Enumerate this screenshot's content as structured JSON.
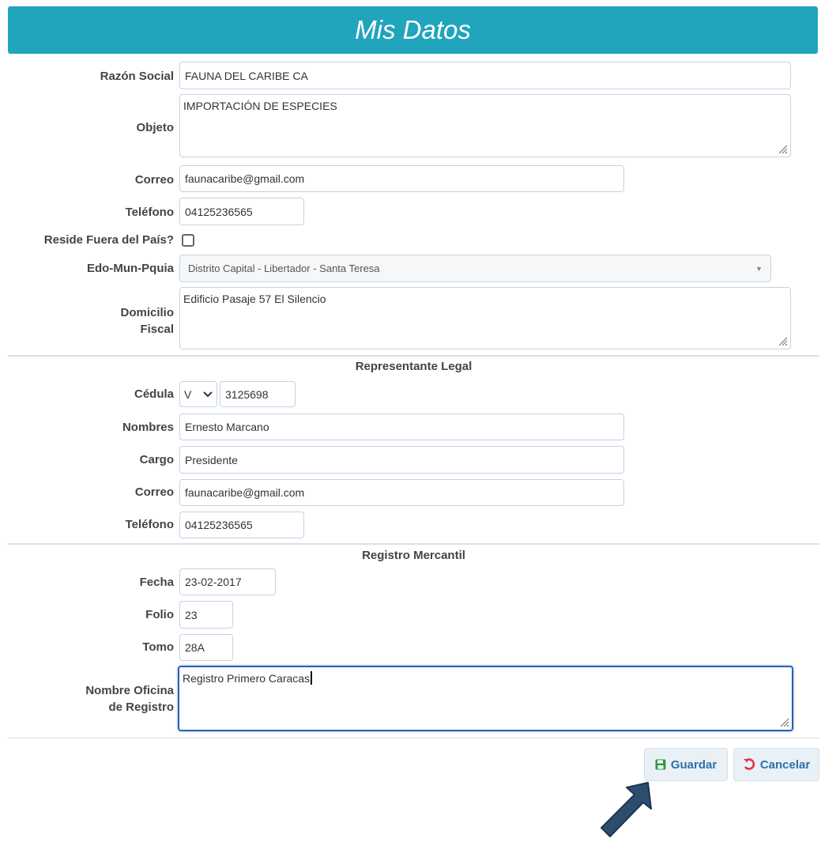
{
  "page_title": "Mis Datos",
  "company": {
    "razon_social_label": "Razón Social",
    "razon_social": "FAUNA DEL CARIBE CA",
    "objeto_label": "Objeto",
    "objeto": "IMPORTACIÓN DE ESPECIES",
    "correo_label": "Correo",
    "correo": "faunacaribe@gmail.com",
    "telefono_label": "Teléfono",
    "telefono": "04125236565",
    "reside_label": "Reside Fuera del País?",
    "reside_checked": false,
    "edo_label": "Edo-Mun-Pquia",
    "edo_value": "Distrito Capital - Libertador - Santa Teresa",
    "domicilio_label_1": "Domicilio",
    "domicilio_label_2": "Fiscal",
    "domicilio": "Edificio Pasaje 57 El Silencio"
  },
  "representante": {
    "section_title": "Representante Legal",
    "cedula_label": "Cédula",
    "cedula_type": "V",
    "cedula": "3125698",
    "nombres_label": "Nombres",
    "nombres": "Ernesto Marcano",
    "cargo_label": "Cargo",
    "cargo": "Presidente",
    "correo_label": "Correo",
    "correo": "faunacaribe@gmail.com",
    "telefono_label": "Teléfono",
    "telefono": "04125236565"
  },
  "registro": {
    "section_title": "Registro Mercantil",
    "fecha_label": "Fecha",
    "fecha": "23-02-2017",
    "folio_label": "Folio",
    "folio": "23",
    "tomo_label": "Tomo",
    "tomo": "28A",
    "oficina_label_1": "Nombre Oficina",
    "oficina_label_2": "de Registro",
    "oficina": "Registro Primero Caracas"
  },
  "actions": {
    "guardar": "Guardar",
    "cancelar": "Cancelar"
  },
  "colors": {
    "header": "#21a5bd",
    "button_text": "#3070a8",
    "save_icon": "#2e9a46",
    "cancel_icon": "#e0334a",
    "arrow": "#2c4d6e"
  }
}
